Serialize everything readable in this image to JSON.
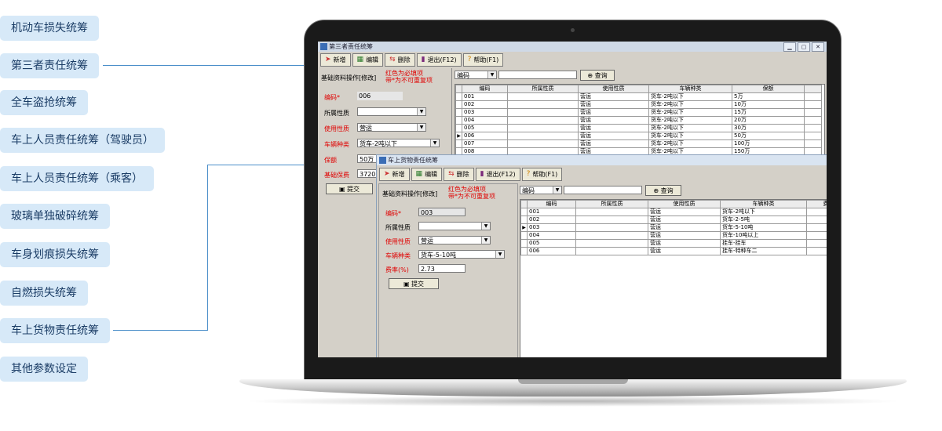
{
  "menu": [
    {
      "label": "机动车损失统筹"
    },
    {
      "label": "第三者责任统筹"
    },
    {
      "label": "全车盗抢统筹"
    },
    {
      "label": "车上人员责任统筹（驾驶员）"
    },
    {
      "label": "车上人员责任统筹（乘客）"
    },
    {
      "label": "玻璃单独破碎统筹"
    },
    {
      "label": "车身划痕损失统筹"
    },
    {
      "label": "自燃损失统筹"
    },
    {
      "label": "车上货物责任统筹"
    },
    {
      "label": "其他参数设定"
    }
  ],
  "colors": {
    "pill_bg": "#d7e9f8",
    "pill_text": "#1b3d66",
    "connector": "#4a8ec9",
    "required": "#e00000"
  },
  "back_window": {
    "title": "第三者责任统筹",
    "toolbar": [
      "新增",
      "编辑",
      "删除",
      "退出(F12)",
      "帮助(F1)"
    ],
    "panel_title": "基础资料操作[修改]",
    "notice_1": "红色为必填项",
    "notice_2": "带*为不可重复项",
    "fields": [
      {
        "label": "编码*",
        "value": "006"
      },
      {
        "label": "所属性质",
        "value": ""
      },
      {
        "label": "使用性质",
        "value": "营运"
      },
      {
        "label": "车辆种类",
        "value": "货车-2吨以下"
      },
      {
        "label": "保额",
        "value": "50万"
      },
      {
        "label": "基础保费",
        "value": "3720"
      }
    ],
    "submit": "提交",
    "search_field": "编码",
    "query_button": "查询",
    "columns": [
      "编码",
      "所属性质",
      "使用性质",
      "车辆种类",
      "保额"
    ],
    "rows": [
      [
        "001",
        "",
        "营运",
        "货车-2吨以下",
        "5万"
      ],
      [
        "002",
        "",
        "营运",
        "货车-2吨以下",
        "10万"
      ],
      [
        "003",
        "",
        "营运",
        "货车-2吨以下",
        "15万"
      ],
      [
        "004",
        "",
        "营运",
        "货车-2吨以下",
        "20万"
      ],
      [
        "005",
        "",
        "营运",
        "货车-2吨以下",
        "30万"
      ],
      [
        "006",
        "",
        "营运",
        "货车-2吨以下",
        "50万"
      ],
      [
        "007",
        "",
        "营运",
        "货车-2吨以下",
        "100万"
      ],
      [
        "008",
        "",
        "营运",
        "货车-2吨以下",
        "150万"
      ]
    ]
  },
  "front_window": {
    "title": "车上货物责任统筹",
    "toolbar": [
      "新增",
      "编辑",
      "删除",
      "退出(F12)",
      "帮助(F1)"
    ],
    "panel_title": "基础资料操作[修改]",
    "notice_1": "红色为必填项",
    "notice_2": "带*为不可重复项",
    "fields": [
      {
        "label": "编码*",
        "value": "003"
      },
      {
        "label": "所属性质",
        "value": ""
      },
      {
        "label": "使用性质",
        "value": "营运"
      },
      {
        "label": "车辆种类",
        "value": "货车-5-10吨"
      },
      {
        "label": "费率(%)",
        "value": "2.73"
      }
    ],
    "submit": "提交",
    "search_field": "编码",
    "query_button": "查询",
    "columns": [
      "编码",
      "所属性质",
      "使用性质",
      "车辆种类",
      "费率"
    ],
    "rows": [
      [
        "001",
        "",
        "营运",
        "货车-2吨以下",
        ""
      ],
      [
        "002",
        "",
        "营运",
        "货车-2-5吨",
        ""
      ],
      [
        "003",
        "",
        "营运",
        "货车-5-10吨",
        ""
      ],
      [
        "004",
        "",
        "营运",
        "货车-10吨以上",
        ""
      ],
      [
        "005",
        "",
        "营运",
        "挂车-挂车",
        ""
      ],
      [
        "006",
        "",
        "营运",
        "挂车-特种车二",
        ""
      ]
    ]
  }
}
